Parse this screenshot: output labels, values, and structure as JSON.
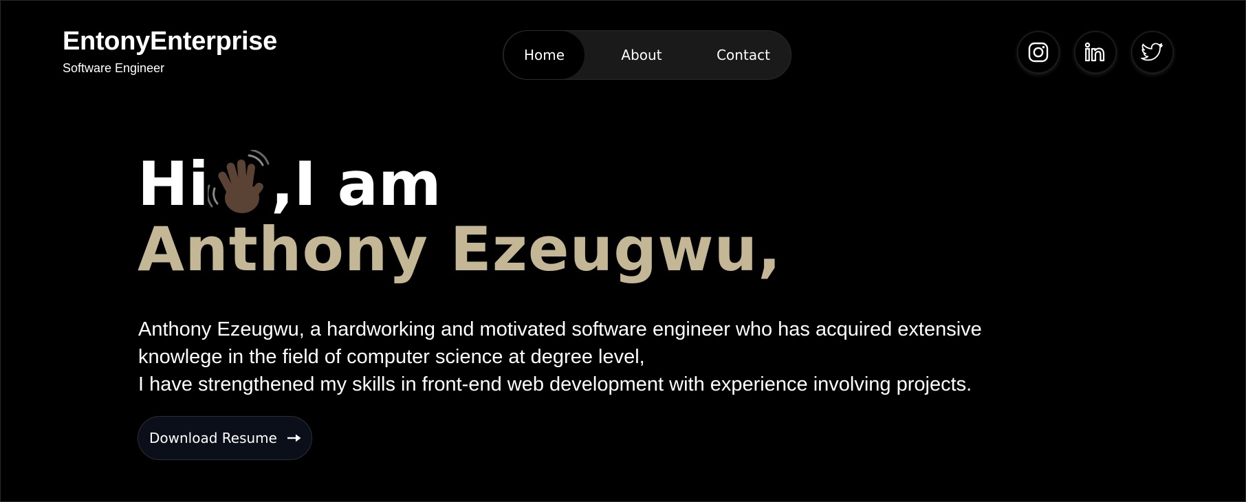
{
  "brand": {
    "name": "EntonyEnterprise",
    "subtitle": "Software Engineer"
  },
  "nav": {
    "items": [
      {
        "label": "Home",
        "active": true
      },
      {
        "label": "About",
        "active": false
      },
      {
        "label": "Contact",
        "active": false
      }
    ]
  },
  "social": [
    {
      "icon": "instagram-icon"
    },
    {
      "icon": "linkedin-icon"
    },
    {
      "icon": "twitter-icon"
    }
  ],
  "hero": {
    "greeting_start": "Hi",
    "greeting_emoji": "waving-hand-icon",
    "greeting_end": ",I am",
    "name": "Anthony Ezeugwu,"
  },
  "intro": {
    "line1": "Anthony Ezeugwu, a hardworking and motivated software engineer who has acquired extensive knowlege in the field of computer science at degree level,",
    "line2": "I have strengthened my skills in front-end web development with experience involving projects."
  },
  "cta": {
    "label": "Download Resume",
    "icon": "arrow-right-icon"
  },
  "colors": {
    "background": "#000000",
    "accent": "#c4b796",
    "nav_bg": "#1a1a1a",
    "button_bg": "#0b0f19"
  }
}
